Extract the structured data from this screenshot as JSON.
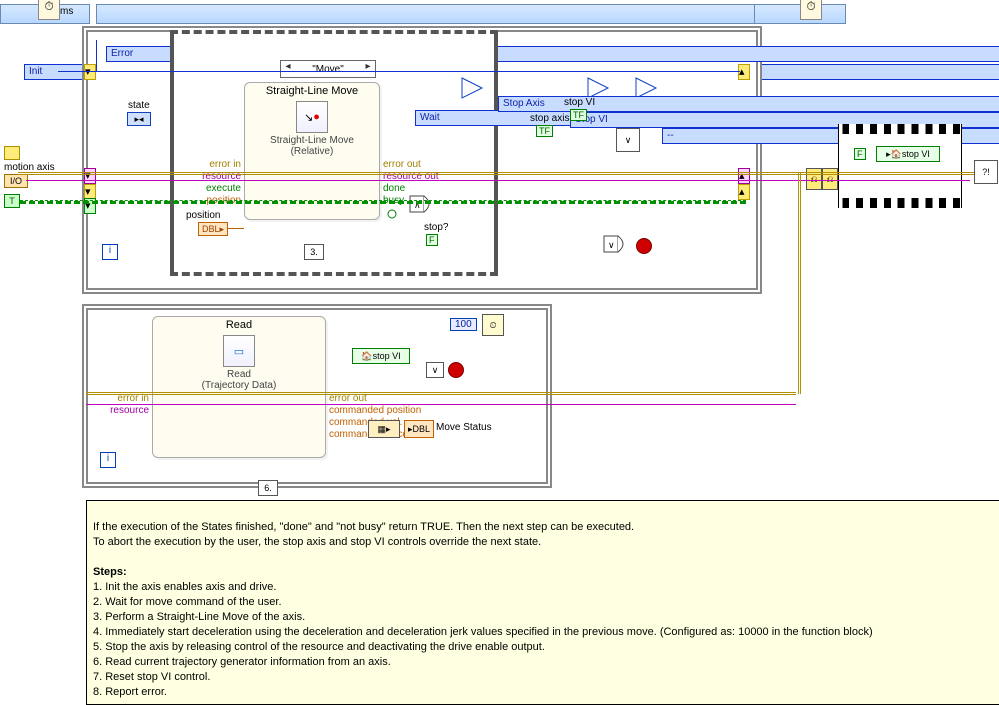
{
  "header": {
    "ms_label": "ms"
  },
  "controls": {
    "error_ring": "Error",
    "init_ring": "Init",
    "motion_axis_label": "motion axis",
    "state_label": "state",
    "stop_axis": "Stop Axis",
    "stop_vi": "Stop VI",
    "dash_ring": "--"
  },
  "case": {
    "selector": "\"Move\""
  },
  "move_node": {
    "title": "Straight-Line Move",
    "sub1": "Straight-Line Move",
    "sub2": "(Relative)",
    "terms": {
      "err_in": "error in",
      "res_in": "resource",
      "exec": "execute",
      "pos": "position",
      "err_out": "error out",
      "res_out": "resource out",
      "done": "done",
      "busy": "busy"
    },
    "position_label": "position",
    "footer": "3."
  },
  "wait_ring": "Wait",
  "stop_q": {
    "label": "stop?",
    "const": "F"
  },
  "stop_axis_ind": {
    "label": "stop axis",
    "tf": "TF"
  },
  "stop_vi_ind": {
    "label": "stop VI",
    "tf": "TF"
  },
  "read_node": {
    "title": "Read",
    "sub1": "Read",
    "sub2": "(Trajectory Data)",
    "terms": {
      "err_in": "error in",
      "res_in": "resource",
      "err_out": "error out",
      "cpos": "commanded position",
      "cvel": "commanded vel.",
      "cacc": "commanded accel."
    },
    "footer": "6."
  },
  "hundred": "100",
  "local_stop": "stop VI",
  "move_status": "Move Status",
  "seq": {
    "f_const": "F",
    "stop_vi": "stop VI"
  },
  "comment": {
    "intro1": "If the execution of the States finished, \"done\" and \"not busy\" return TRUE. Then the next step can be executed.",
    "intro2": "To abort the execution by the user, the stop axis and stop VI controls override the next state.",
    "steps_hdr": "Steps:",
    "s1": "1. Init the axis enables axis and drive.",
    "s2": "2. Wait for move command of the user.",
    "s3": "3. Perform a Straight-Line Move of the axis.",
    "s4": "4. Immediately start deceleration using the deceleration and deceleration jerk values specified in the previous move. (Configured as: 10000 in the function block)",
    "s5": "5. Stop the axis by releasing control of the resource and deactivating the drive enable output.",
    "s6": "6. Read current trajectory generator information from an axis.",
    "s7": "7. Reset stop VI control.",
    "s8": "8. Report error."
  }
}
